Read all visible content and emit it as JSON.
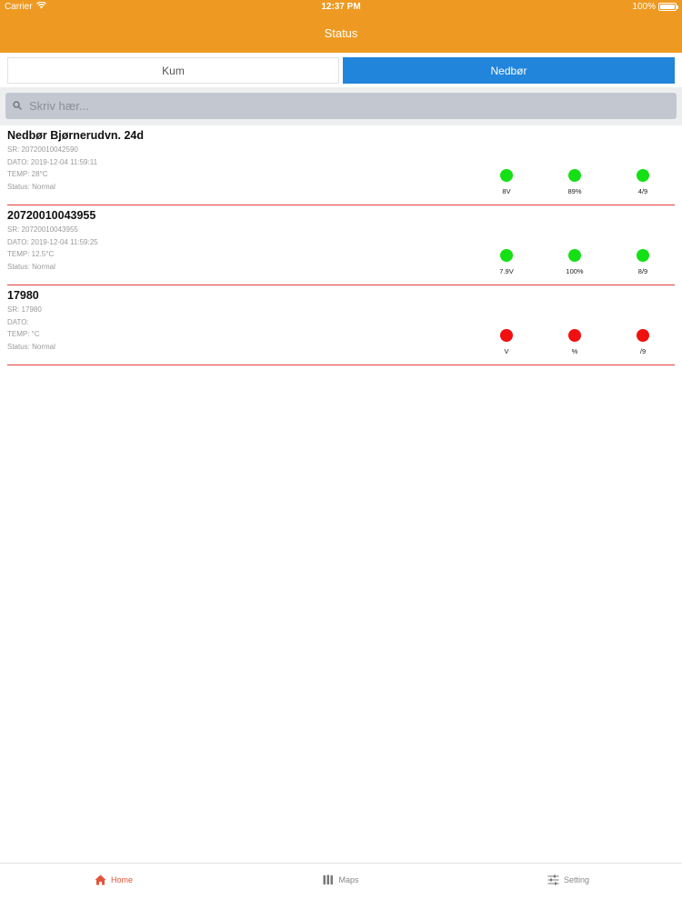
{
  "status_bar": {
    "carrier": "Carrier",
    "time": "12:37 PM",
    "battery": "100%"
  },
  "nav": {
    "title": "Status"
  },
  "segments": {
    "left": "Kum",
    "right": "Nedbør",
    "selected": "Nedbør"
  },
  "search": {
    "placeholder": "Skriv hær..."
  },
  "stations": [
    {
      "title": "Nedbør Bjørnerudvn. 24d",
      "sr": "SR: 20720010042590",
      "dato": "DATO: 2019-12-04 11:59:11",
      "temp": "TEMP: 28°C",
      "status": "Status: Normal",
      "indicators": [
        {
          "label": "8V",
          "color": "green"
        },
        {
          "label": "89%",
          "color": "green"
        },
        {
          "label": "4/9",
          "color": "green"
        }
      ]
    },
    {
      "title": "20720010043955",
      "sr": "SR: 20720010043955",
      "dato": "DATO: 2019-12-04 11:59:25",
      "temp": "TEMP: 12.5°C",
      "status": "Status: Normal",
      "indicators": [
        {
          "label": "7.9V",
          "color": "green"
        },
        {
          "label": "100%",
          "color": "green"
        },
        {
          "label": "8/9",
          "color": "green"
        }
      ]
    },
    {
      "title": "17980",
      "sr": "SR: 17980",
      "dato": "DATO:",
      "temp": "TEMP: °C",
      "status": "Status: Normal",
      "indicators": [
        {
          "label": "V",
          "color": "red"
        },
        {
          "label": "%",
          "color": "red"
        },
        {
          "label": "/9",
          "color": "red"
        }
      ]
    }
  ],
  "tabs": [
    {
      "label": "Home",
      "icon": "home-icon",
      "active": true
    },
    {
      "label": "Maps",
      "icon": "maps-icon",
      "active": false
    },
    {
      "label": "Setting",
      "icon": "settings-sliders-icon",
      "active": false
    }
  ],
  "colors": {
    "nav_bar": "#EE9A22",
    "segment_selected": "#2185DC",
    "row_divider": "#E23B3B",
    "status_ok": "#15E015",
    "status_error": "#F01010",
    "tab_active": "#E0553B"
  }
}
